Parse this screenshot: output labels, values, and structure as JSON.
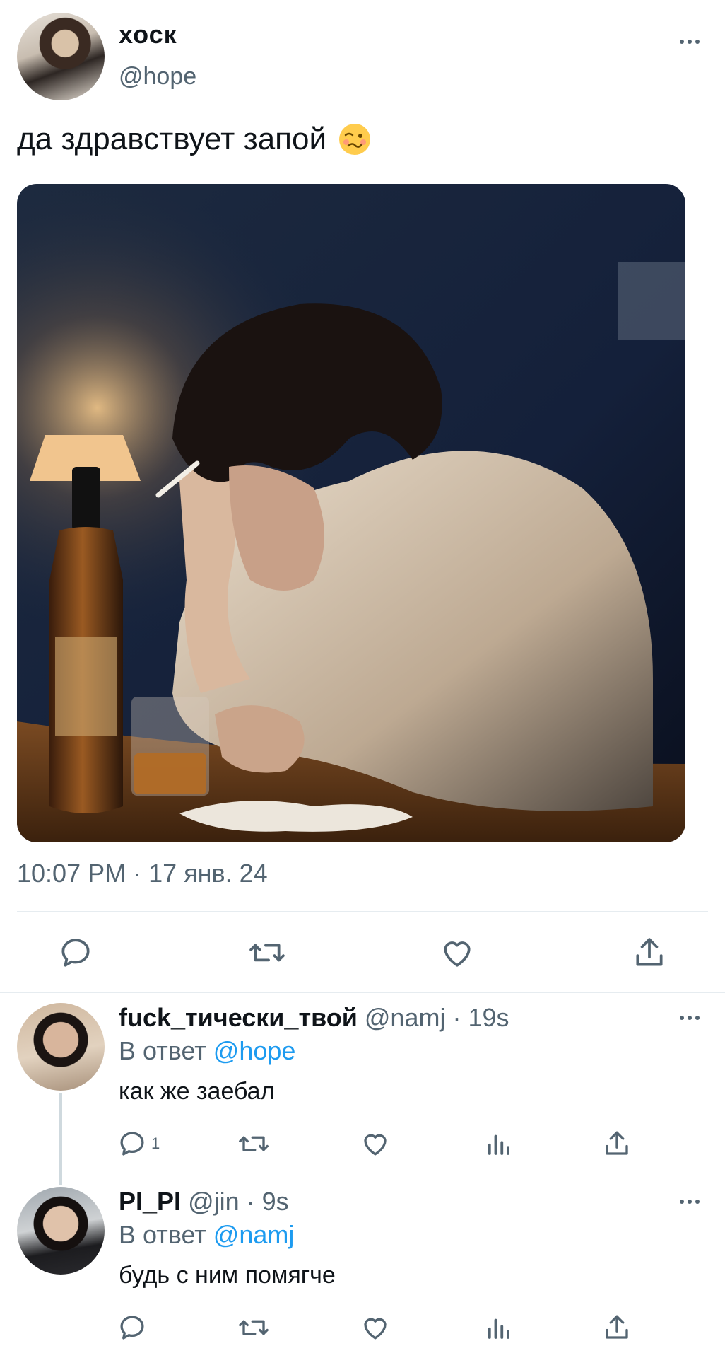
{
  "tweet": {
    "display_name": "хоск",
    "handle": "@hope",
    "text": "да здравствует запой",
    "timestamp": "10:07 PM · 17 янв. 24"
  },
  "replies": [
    {
      "display_name": "fuck_тически_твой",
      "meta": "@namj · 19s",
      "reply_prefix": "В ответ ",
      "reply_to": "@hope",
      "text": "как же заебал",
      "reply_count": "1"
    },
    {
      "display_name": "PI_PI",
      "meta": "@jin · 9s",
      "reply_prefix": "В ответ ",
      "reply_to": "@namj",
      "text": "будь с ним помягче",
      "reply_count": ""
    }
  ],
  "colors": {
    "accent": "#1d9bf0",
    "text": "#0f1419",
    "secondary": "#536471",
    "divider": "#e6ecf0"
  },
  "icons": [
    "more-icon",
    "reply-icon",
    "retweet-icon",
    "like-icon",
    "analytics-icon",
    "share-icon"
  ]
}
